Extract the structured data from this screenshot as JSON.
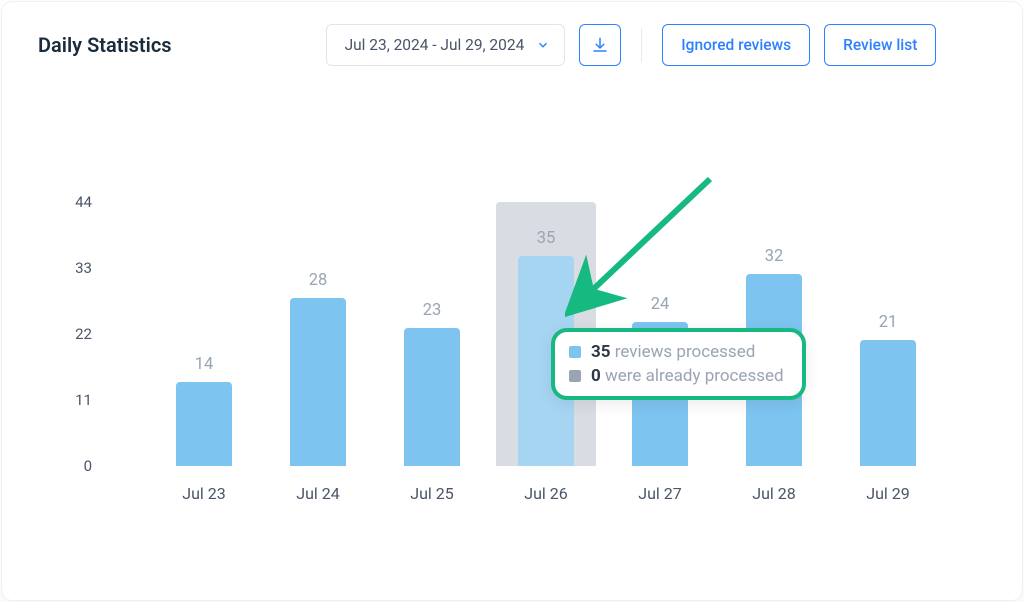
{
  "header": {
    "title": "Daily Statistics",
    "datepicker_label": "Jul 23, 2024 - Jul 29, 2024",
    "ignored_label": "Ignored reviews",
    "reviewlist_label": "Review list"
  },
  "chart_data": {
    "type": "bar",
    "categories": [
      "Jul 23",
      "Jul 24",
      "Jul 25",
      "Jul 26",
      "Jul 27",
      "Jul 28",
      "Jul 29"
    ],
    "values": [
      14,
      28,
      23,
      35,
      24,
      32,
      21
    ],
    "secondary": [
      0,
      0,
      0,
      0,
      0,
      0,
      0
    ],
    "ylim": [
      0,
      44
    ],
    "y_ticks": [
      0,
      11,
      22,
      33,
      44
    ],
    "highlight_index": 3
  },
  "tooltip": {
    "value1": "35",
    "label1": "reviews processed",
    "value2": "0",
    "label2": "were already processed"
  }
}
